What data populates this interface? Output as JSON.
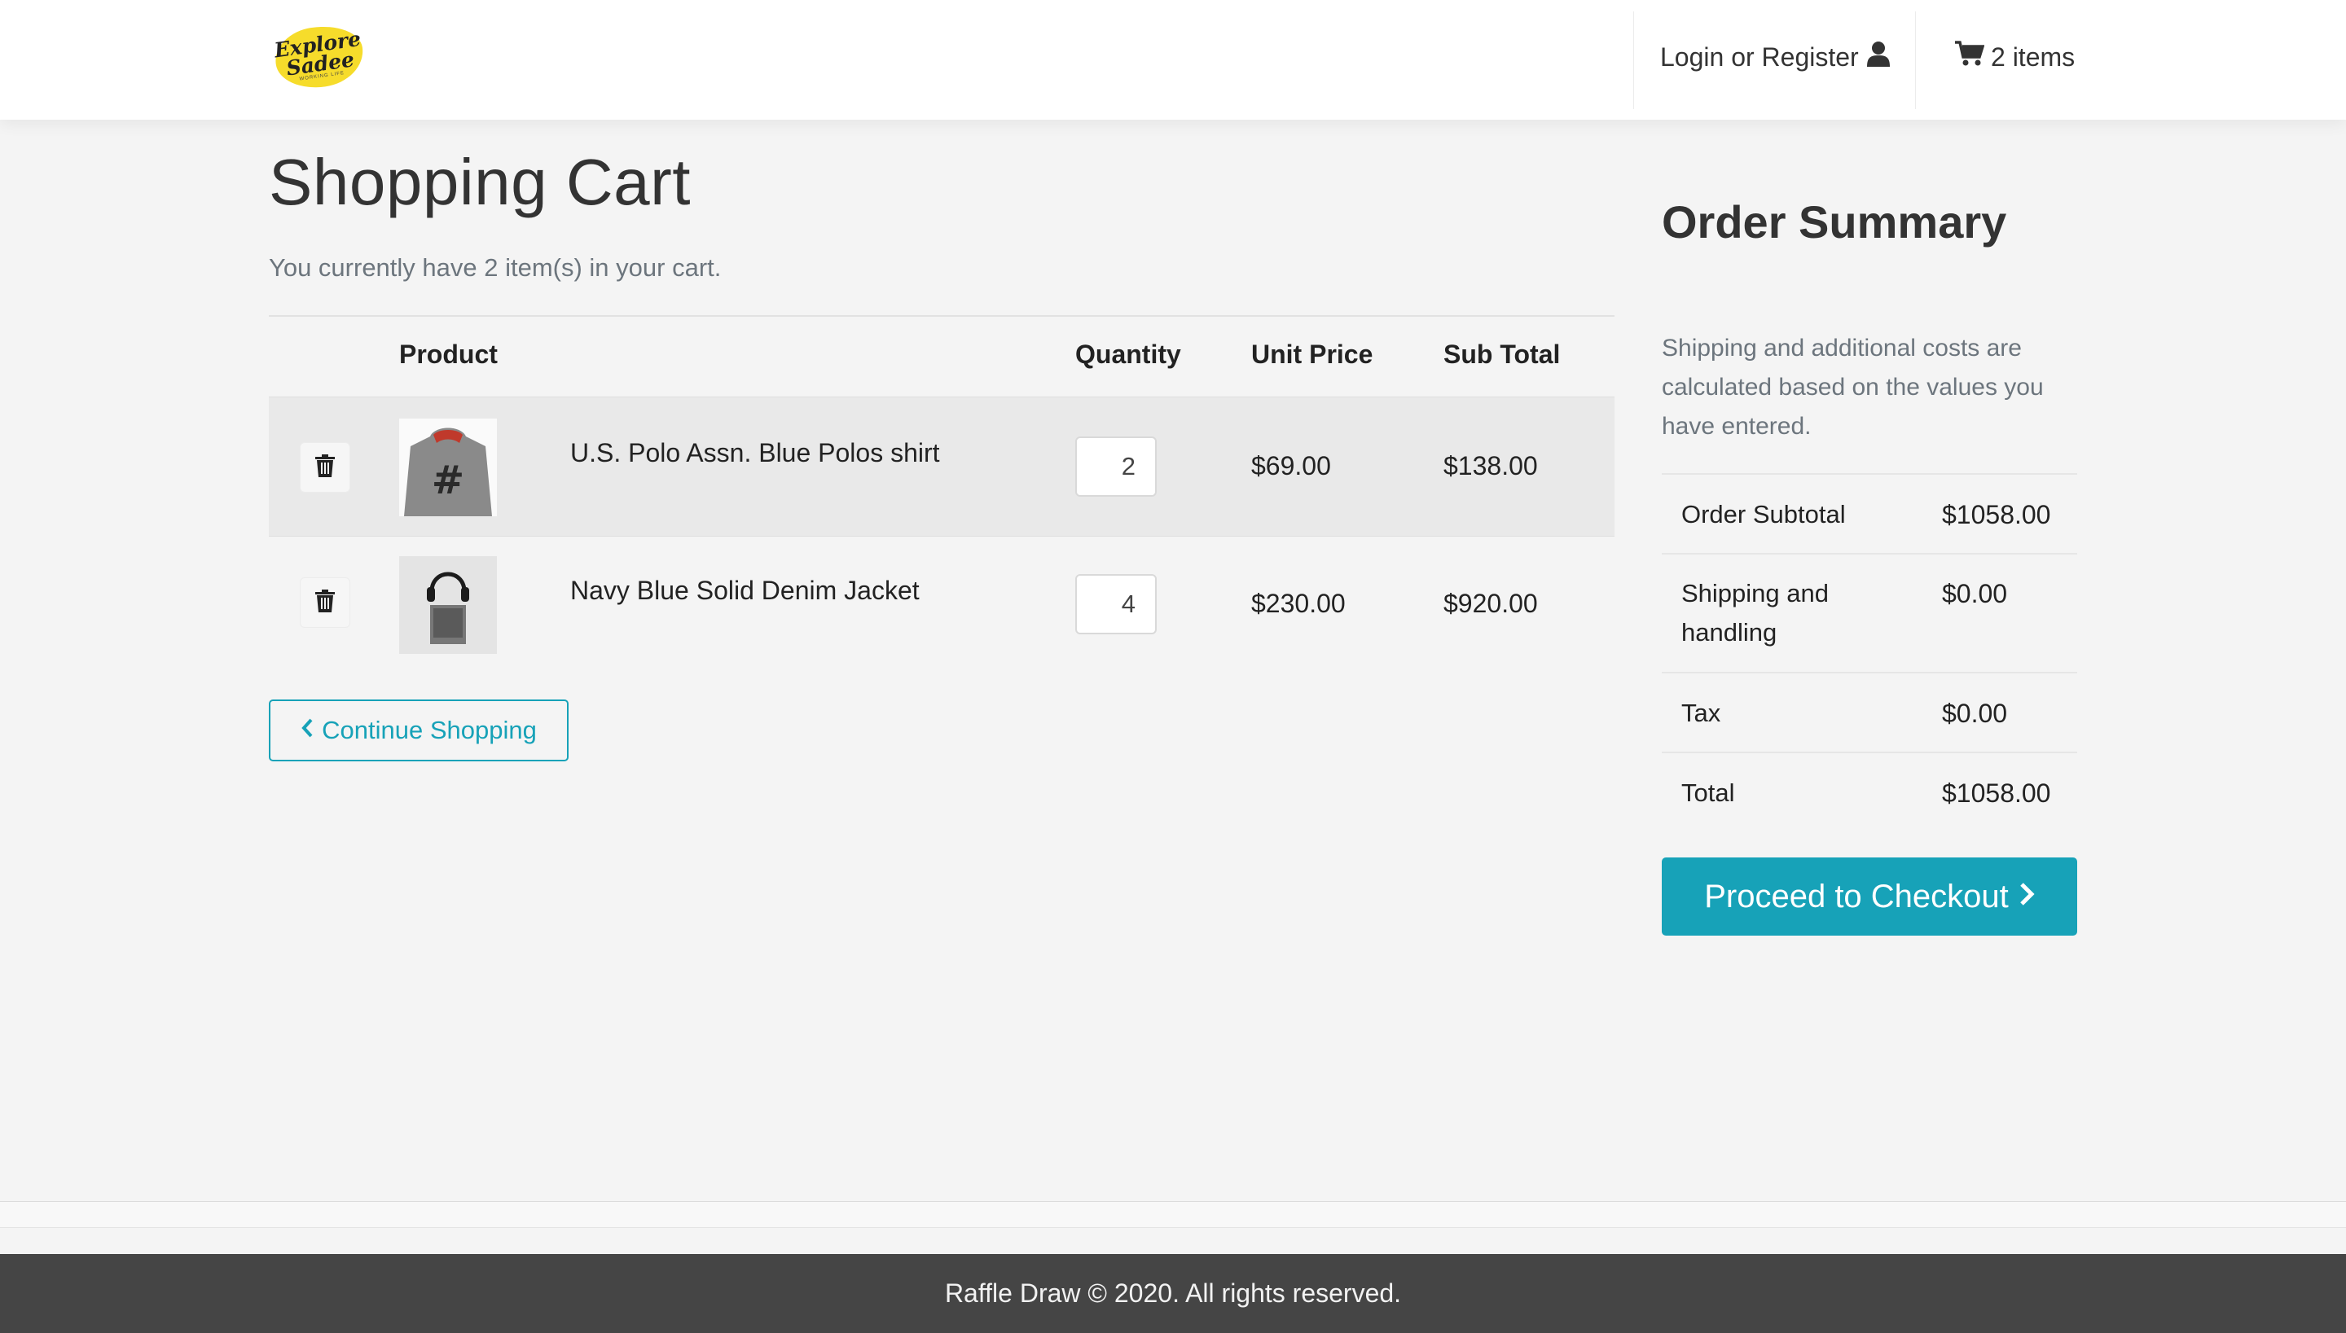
{
  "header": {
    "logo": {
      "line1": "Explore",
      "line2": "Sadee",
      "tagline": "WORKING LIFE"
    },
    "login_label": "Login or Register",
    "cart_label": "2 items"
  },
  "cart": {
    "title": "Shopping Cart",
    "count_text": "You currently have 2 item(s) in your cart.",
    "columns": [
      "Product",
      "Quantity",
      "Unit Price",
      "Sub Total"
    ],
    "items": [
      {
        "name": "U.S. Polo Assn. Blue Polos shirt",
        "quantity": "2",
        "unit_price": "$69.00",
        "sub_total": "$138.00"
      },
      {
        "name": "Navy Blue Solid Denim Jacket",
        "quantity": "4",
        "unit_price": "$230.00",
        "sub_total": "$920.00"
      }
    ],
    "continue_label": "Continue Shopping"
  },
  "summary": {
    "title": "Order Summary",
    "note": "Shipping and additional costs are calculated based on the values you have entered.",
    "rows": [
      {
        "label": "Order Subtotal",
        "value": "$1058.00"
      },
      {
        "label": "Shipping and handling",
        "value": "$0.00"
      },
      {
        "label": "Tax",
        "value": "$0.00"
      },
      {
        "label": "Total",
        "value": "$1058.00"
      }
    ],
    "checkout_label": "Proceed to Checkout"
  },
  "footer": {
    "text": "Raffle Draw © 2020. All rights reserved."
  },
  "colors": {
    "accent": "#17a2b8",
    "footer_bg": "#454545",
    "logo_yellow": "#f6dc2b"
  }
}
